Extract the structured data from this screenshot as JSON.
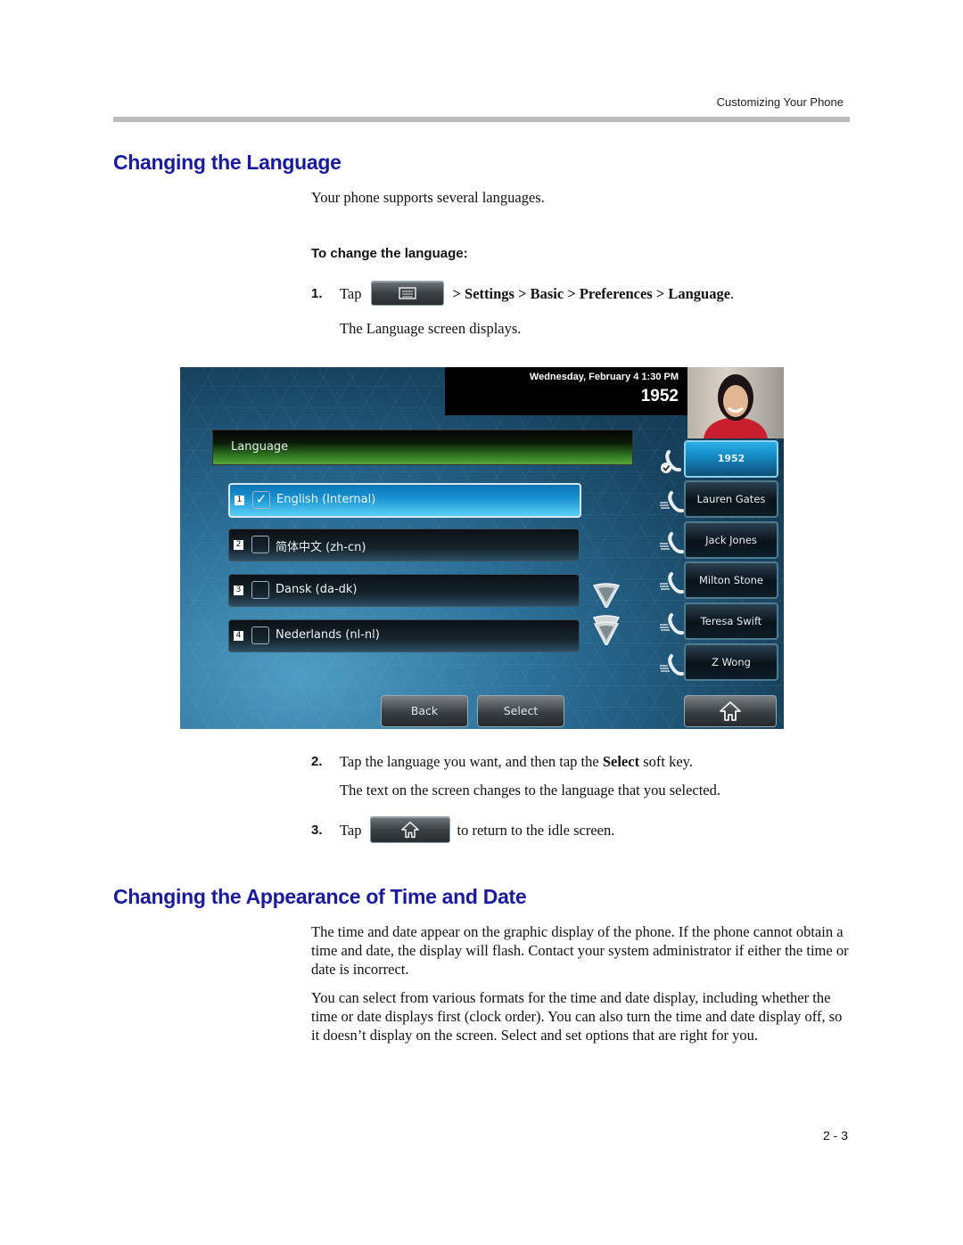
{
  "header": {
    "running_title": "Customizing Your Phone"
  },
  "section1": {
    "title": "Changing the Language",
    "intro": "Your phone supports several languages.",
    "procedure_heading": "To change the language:",
    "steps": [
      {
        "num": "1.",
        "prefix": "Tap",
        "path": "> Settings > Basic > Preferences > Language",
        "suffix": ".",
        "note": "The Language screen displays."
      },
      {
        "num": "2.",
        "text_a": "Tap the language you want, and then tap the ",
        "text_bold": "Select",
        "text_b": " soft key.",
        "note": "The text on the screen changes to the language that you selected."
      },
      {
        "num": "3.",
        "prefix": "Tap",
        "suffix": "to return to the idle screen."
      }
    ]
  },
  "phone_screen": {
    "date_time": "Wednesday, February 4  1:30 PM",
    "extension": "1952",
    "screen_title": "Language",
    "languages": [
      {
        "num": "1",
        "label": "English (Internal)",
        "checked": true
      },
      {
        "num": "2",
        "label": "简体中文 (zh-cn)",
        "checked": false
      },
      {
        "num": "3",
        "label": "Dansk (da-dk)",
        "checked": false
      },
      {
        "num": "4",
        "label": "Nederlands (nl-nl)",
        "checked": false
      }
    ],
    "line_keys": [
      "1952",
      "Lauren Gates",
      "Jack Jones",
      "Milton Stone",
      "Teresa Swift",
      "Z Wong"
    ],
    "softkeys": {
      "back": "Back",
      "select": "Select"
    },
    "check_glyph": "✓"
  },
  "section2": {
    "title": "Changing the Appearance of Time and Date",
    "para1": "The time and date appear on the graphic display of the phone. If the phone cannot obtain a time and date, the display will flash. Contact your system administrator if either the time or date is incorrect.",
    "para2": "You can select from various formats for the time and date display, including whether the time or date displays first (clock order). You can also turn the time and date display off, so it doesn’t display on the screen. Select and set options that are right for you."
  },
  "footer": {
    "page_number": "2 - 3"
  }
}
